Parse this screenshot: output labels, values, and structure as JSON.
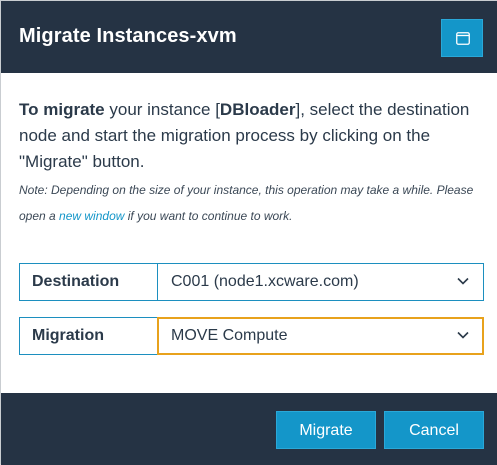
{
  "dialog": {
    "title": "Migrate Instances-xvm",
    "maximize_icon": "window-maximize-icon"
  },
  "intro": {
    "bold_prefix": "To migrate",
    "text_1": " your instance [",
    "instance_name": "DBloader",
    "text_2": "], select the destination node and start the migration process by clicking on the \"Migrate\" button."
  },
  "note": {
    "text_before": "Note: Depending on the size of your instance, this operation may take a while. Please open a ",
    "link": "new window",
    "text_after": " if you want to continue to work."
  },
  "form": {
    "destination": {
      "label": "Destination",
      "value": "C001 (node1.xcware.com)"
    },
    "migration": {
      "label": "Migration",
      "value": "MOVE Compute"
    }
  },
  "buttons": {
    "migrate": "Migrate",
    "cancel": "Cancel"
  },
  "colors": {
    "header_bg": "#253344",
    "accent": "#1496c9",
    "focus_border": "#e8a21c"
  }
}
